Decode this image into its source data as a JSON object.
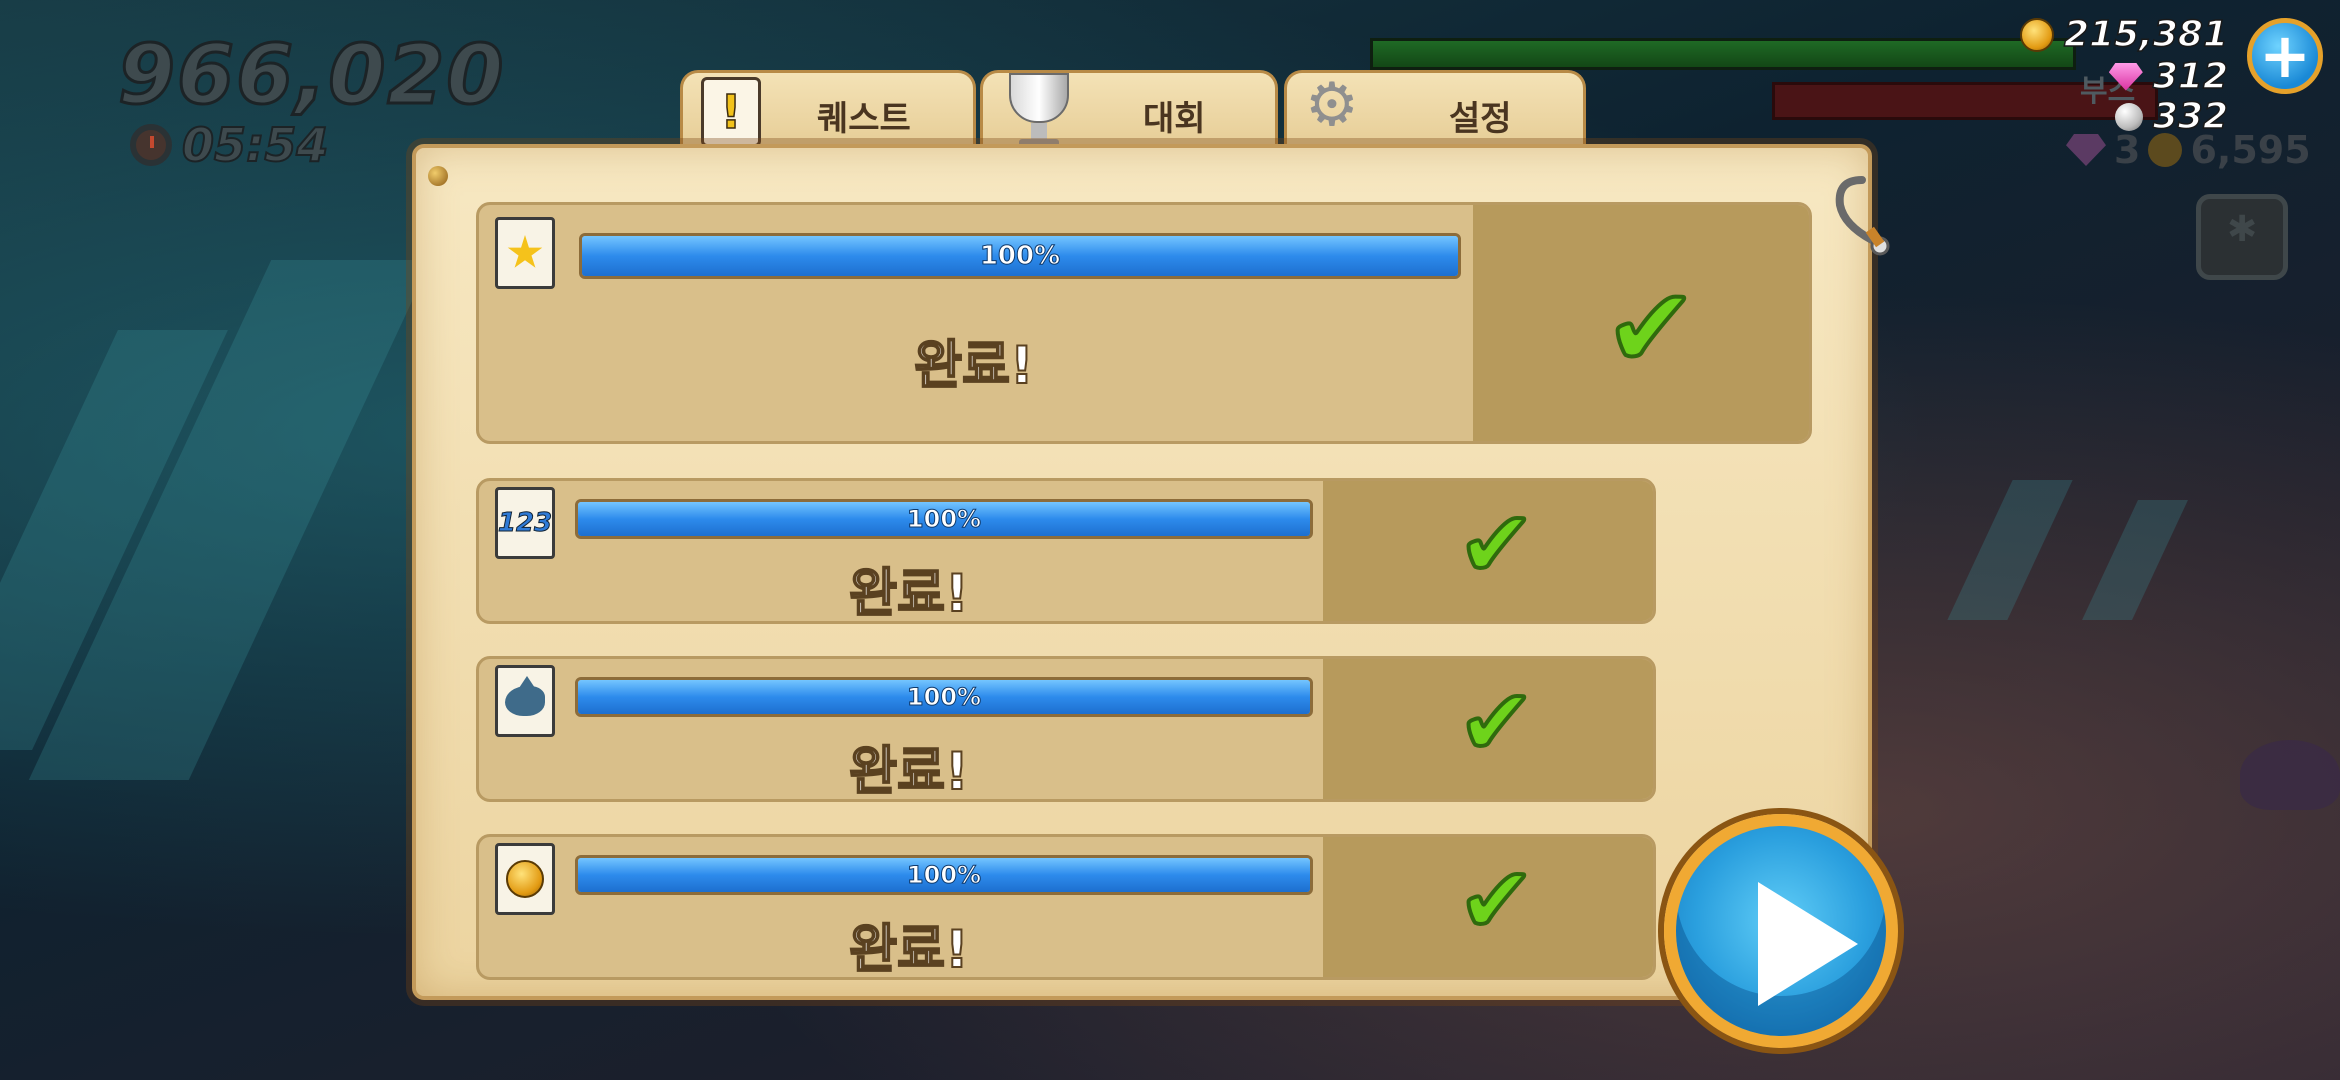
{
  "hud": {
    "score": "966,020",
    "timer": "05:54",
    "coins": "215,381",
    "gems": "312",
    "pearls": "332",
    "dimmed_label": "부스",
    "dimmed_gems": "3",
    "dimmed_coins": "6,595",
    "plus_label": "+"
  },
  "tabs": [
    {
      "label": "퀘스트",
      "icon": "quest-icon"
    },
    {
      "label": "대회",
      "icon": "trophy-icon"
    },
    {
      "label": "설정",
      "icon": "gear-icon"
    }
  ],
  "quests": [
    {
      "icon": "star-quest-icon",
      "progress": 1.0,
      "progress_label": "100%",
      "status": "완료!",
      "check": "✔"
    },
    {
      "icon": "number-quest-icon",
      "icon_text": "123",
      "progress": 1.0,
      "progress_label": "100%",
      "status": "완료!",
      "check": "✔"
    },
    {
      "icon": "shark-quest-icon",
      "progress": 1.0,
      "progress_label": "100%",
      "status": "완료!",
      "check": "✔"
    },
    {
      "icon": "coins-quest-icon",
      "progress": 1.0,
      "progress_label": "100%",
      "status": "완료!",
      "check": "✔"
    }
  ],
  "colors": {
    "progress_blue": "#2d8bec",
    "check_green": "#6ed31b",
    "panel_parchment": "#f7e8c2",
    "play_button_rim": "#f0a933"
  }
}
